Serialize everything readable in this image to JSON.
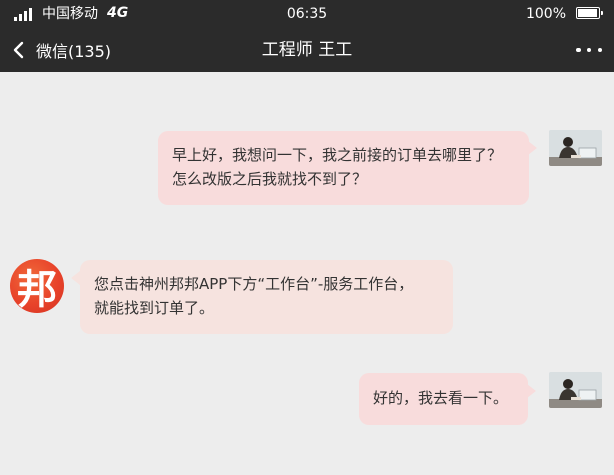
{
  "status_bar": {
    "carrier": "中国移动",
    "network": "4G",
    "time": "06:35",
    "battery_percent": "100%",
    "battery_level": 1.0
  },
  "nav_bar": {
    "back_label": "微信(135)",
    "title": "工程师 王工"
  },
  "messages": [
    {
      "direction": "outgoing",
      "lines": [
        "早上好，我想问一下，我之前接的订单去哪里了？",
        "怎么改版之后我就找不到了？"
      ]
    },
    {
      "direction": "incoming",
      "avatar_text": "邦",
      "lines": [
        "您点击神州邦邦APP下方“工作台”-服务工作台，",
        "就能找到订单了。"
      ]
    },
    {
      "direction": "outgoing",
      "lines": [
        "好的，我去看一下。"
      ]
    }
  ],
  "colors": {
    "bar_background": "#2b2b2b",
    "chat_background": "#ededed",
    "outgoing_bubble": "#f8dcdc",
    "incoming_bubble": "#f6e3df",
    "logo_red": "#e8432a"
  },
  "icons": {
    "back": "chevron-left-icon",
    "more": "more-horizontal-icon",
    "signal": "signal-bars-icon",
    "battery": "battery-icon"
  }
}
